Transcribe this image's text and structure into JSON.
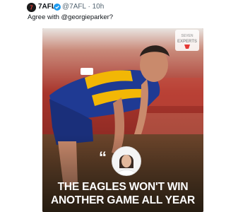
{
  "tweet": {
    "display_name": "7AFL",
    "handle_time": "@7AFL · 10h",
    "text_prefix": "Agree with ",
    "mention": "@georgieparker",
    "text_suffix": "?"
  },
  "badge": {
    "line1": "SEVEN",
    "line2": "EXPERTS"
  },
  "headline": {
    "line1": "THE EAGLES WON'T WIN",
    "line2": "ANOTHER GAME ALL YEAR"
  },
  "colors": {
    "team_blue": "#1f3a93",
    "team_gold": "#f2b705",
    "backdrop_red": "#a8352c",
    "verified_blue": "#1d9bf0"
  }
}
